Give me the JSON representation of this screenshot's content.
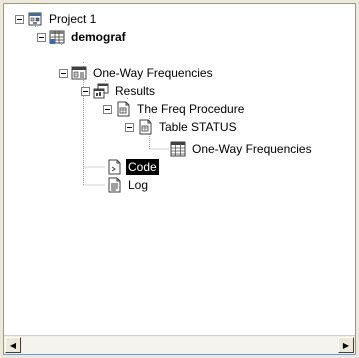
{
  "tree": {
    "project": {
      "label": "Project 1",
      "icon": "project-icon"
    },
    "dataset": {
      "label": "demograf",
      "icon": "dataset-grid-icon"
    },
    "task": {
      "label": "One-Way Frequencies",
      "icon": "task-window-icon"
    },
    "results": {
      "label": "Results",
      "icon": "results-icon"
    },
    "procedure": {
      "label": "The Freq Procedure",
      "icon": "document-chart-icon"
    },
    "table": {
      "label": "Table STATUS",
      "icon": "document-chart-icon"
    },
    "output": {
      "label": "One-Way Frequencies",
      "icon": "table-grid-icon"
    },
    "code": {
      "label": "Code",
      "icon": "code-document-icon",
      "selected": true
    },
    "log": {
      "label": "Log",
      "icon": "log-document-icon"
    }
  },
  "scrollbar": {
    "left_arrow": "◀",
    "right_arrow": "▶"
  }
}
